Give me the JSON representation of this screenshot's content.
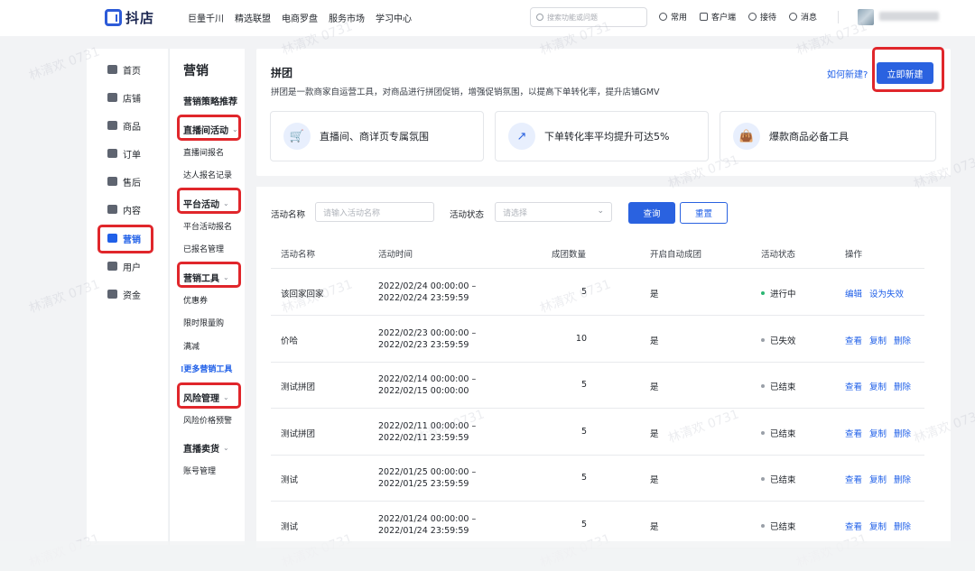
{
  "topbar": {
    "logo_text": "抖店",
    "nav": [
      "巨量千川",
      "精选联盟",
      "电商罗盘",
      "服务市场",
      "学习中心"
    ],
    "search_placeholder": "搜索功能或问题",
    "right": [
      "常用",
      "客户端",
      "接待",
      "消息"
    ]
  },
  "leftnav": {
    "items": [
      {
        "label": "首页",
        "icon": "home-icon"
      },
      {
        "label": "店铺",
        "icon": "shop-icon"
      },
      {
        "label": "商品",
        "icon": "goods-icon"
      },
      {
        "label": "订单",
        "icon": "order-icon"
      },
      {
        "label": "售后",
        "icon": "after-sale-icon"
      },
      {
        "label": "内容",
        "icon": "content-icon"
      },
      {
        "label": "营销",
        "icon": "marketing-icon",
        "active": true
      },
      {
        "label": "用户",
        "icon": "user-icon"
      },
      {
        "label": "资金",
        "icon": "funds-icon"
      }
    ]
  },
  "subnav": {
    "title": "营销",
    "strategy": "营销策略推荐",
    "group_live": "直播间活动",
    "live_signup": "直播间报名",
    "talent_records": "达人报名记录",
    "group_platform": "平台活动",
    "platform_signup": "平台活动报名",
    "signed_manage": "已报名管理",
    "group_tools": "营销工具",
    "coupon": "优惠券",
    "limited": "限时限量购",
    "discount": "满减",
    "more_tools": "更多营销工具",
    "group_risk": "风险管理",
    "price_warning": "风险价格预警",
    "group_live_sale": "直播卖货",
    "account_manage": "账号管理"
  },
  "intro": {
    "title": "拼团",
    "desc": "拼团是一款商家自运营工具，对商品进行拼团促销，增强促销氛围，以提高下单转化率，提升店铺GMV",
    "howto": "如何新建?",
    "new_button": "立即新建",
    "features": [
      "直播间、商详页专属氛围",
      "下单转化率平均提升可达5%",
      "爆款商品必备工具"
    ]
  },
  "filter": {
    "name_label": "活动名称",
    "name_placeholder": "请输入活动名称",
    "status_label": "活动状态",
    "status_placeholder": "请选择",
    "query": "查询",
    "reset": "重置"
  },
  "table": {
    "headers": [
      "活动名称",
      "活动时间",
      "成团数量",
      "开启自动成团",
      "活动状态",
      "操作"
    ],
    "rows": [
      {
        "name": "该回家回家",
        "start": "2022/02/24 00:00:00 –",
        "end": "2022/02/24 23:59:59",
        "count": "5",
        "auto": "是",
        "status": "进行中",
        "active": true,
        "ops": [
          "编辑",
          "设为失效"
        ]
      },
      {
        "name": "价哈",
        "start": "2022/02/23 00:00:00 –",
        "end": "2022/02/23 23:59:59",
        "count": "10",
        "auto": "是",
        "status": "已失效",
        "active": false,
        "ops": [
          "查看",
          "复制",
          "删除"
        ]
      },
      {
        "name": "测试拼团",
        "start": "2022/02/14 00:00:00 –",
        "end": "2022/02/15 00:00:00",
        "count": "5",
        "auto": "是",
        "status": "已结束",
        "active": false,
        "ops": [
          "查看",
          "复制",
          "删除"
        ]
      },
      {
        "name": "测试拼团",
        "start": "2022/02/11 00:00:00 –",
        "end": "2022/02/11 23:59:59",
        "count": "5",
        "auto": "是",
        "status": "已结束",
        "active": false,
        "ops": [
          "查看",
          "复制",
          "删除"
        ]
      },
      {
        "name": "测试",
        "start": "2022/01/25 00:00:00 –",
        "end": "2022/01/25 23:59:59",
        "count": "5",
        "auto": "是",
        "status": "已结束",
        "active": false,
        "ops": [
          "查看",
          "复制",
          "删除"
        ]
      },
      {
        "name": "测试",
        "start": "2022/01/24 00:00:00 –",
        "end": "2022/01/24 23:59:59",
        "count": "5",
        "auto": "是",
        "status": "已结束",
        "active": false,
        "ops": [
          "查看",
          "复制",
          "删除"
        ]
      }
    ]
  },
  "watermark": "林清欢 0731",
  "colors": {
    "accent": "#2a62e0",
    "highlight": "#e0262b",
    "success": "#2bb673"
  }
}
